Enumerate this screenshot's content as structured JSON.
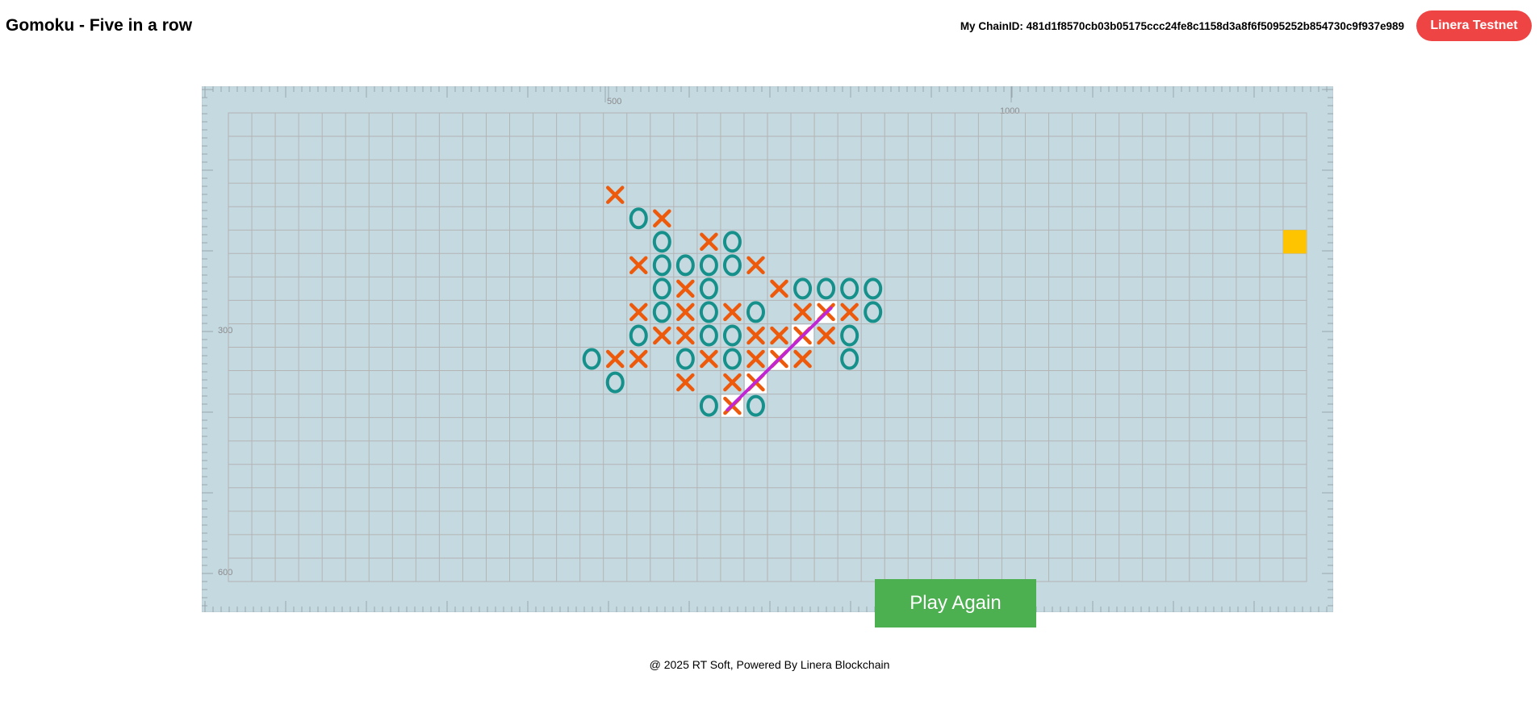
{
  "header": {
    "title": "Gomoku - Five in a row",
    "chain_label": "My ChainID:",
    "chain_id": "481d1f8570cb03b05175ccc24fe8c1158d3a8f6f5095252b854730c9f937e989",
    "network_button": "Linera Testnet"
  },
  "ruler": {
    "labels_top": [
      "500",
      "1000"
    ],
    "labels_left": [
      "300",
      "600"
    ]
  },
  "board": {
    "cols": 46,
    "rows": 20,
    "x_color": "#ee5a0c",
    "o_color": "#16908a",
    "win_line_color": "#c026d3",
    "indicator_color": "#ffc400",
    "pieces": [
      {
        "c": 16,
        "r": 3,
        "p": "X"
      },
      {
        "c": 17,
        "r": 4,
        "p": "O"
      },
      {
        "c": 18,
        "r": 4,
        "p": "X"
      },
      {
        "c": 18,
        "r": 5,
        "p": "O"
      },
      {
        "c": 20,
        "r": 5,
        "p": "X"
      },
      {
        "c": 21,
        "r": 5,
        "p": "O"
      },
      {
        "c": 17,
        "r": 6,
        "p": "X"
      },
      {
        "c": 18,
        "r": 6,
        "p": "O"
      },
      {
        "c": 19,
        "r": 6,
        "p": "O"
      },
      {
        "c": 20,
        "r": 6,
        "p": "O"
      },
      {
        "c": 21,
        "r": 6,
        "p": "O"
      },
      {
        "c": 22,
        "r": 6,
        "p": "X"
      },
      {
        "c": 18,
        "r": 7,
        "p": "O"
      },
      {
        "c": 19,
        "r": 7,
        "p": "X"
      },
      {
        "c": 20,
        "r": 7,
        "p": "O"
      },
      {
        "c": 23,
        "r": 7,
        "p": "X"
      },
      {
        "c": 24,
        "r": 7,
        "p": "O"
      },
      {
        "c": 25,
        "r": 7,
        "p": "O"
      },
      {
        "c": 26,
        "r": 7,
        "p": "O"
      },
      {
        "c": 27,
        "r": 7,
        "p": "O"
      },
      {
        "c": 17,
        "r": 8,
        "p": "X"
      },
      {
        "c": 18,
        "r": 8,
        "p": "O"
      },
      {
        "c": 19,
        "r": 8,
        "p": "X"
      },
      {
        "c": 20,
        "r": 8,
        "p": "O"
      },
      {
        "c": 21,
        "r": 8,
        "p": "X"
      },
      {
        "c": 22,
        "r": 8,
        "p": "O"
      },
      {
        "c": 24,
        "r": 8,
        "p": "X"
      },
      {
        "c": 25,
        "r": 8,
        "p": "X"
      },
      {
        "c": 26,
        "r": 8,
        "p": "X"
      },
      {
        "c": 27,
        "r": 8,
        "p": "O"
      },
      {
        "c": 17,
        "r": 9,
        "p": "O"
      },
      {
        "c": 18,
        "r": 9,
        "p": "X"
      },
      {
        "c": 19,
        "r": 9,
        "p": "X"
      },
      {
        "c": 20,
        "r": 9,
        "p": "O"
      },
      {
        "c": 21,
        "r": 9,
        "p": "O"
      },
      {
        "c": 22,
        "r": 9,
        "p": "X"
      },
      {
        "c": 23,
        "r": 9,
        "p": "X"
      },
      {
        "c": 24,
        "r": 9,
        "p": "X"
      },
      {
        "c": 25,
        "r": 9,
        "p": "X"
      },
      {
        "c": 26,
        "r": 9,
        "p": "O"
      },
      {
        "c": 15,
        "r": 10,
        "p": "O"
      },
      {
        "c": 16,
        "r": 10,
        "p": "X"
      },
      {
        "c": 17,
        "r": 10,
        "p": "X"
      },
      {
        "c": 19,
        "r": 10,
        "p": "O"
      },
      {
        "c": 20,
        "r": 10,
        "p": "X"
      },
      {
        "c": 21,
        "r": 10,
        "p": "O"
      },
      {
        "c": 22,
        "r": 10,
        "p": "X"
      },
      {
        "c": 23,
        "r": 10,
        "p": "X"
      },
      {
        "c": 24,
        "r": 10,
        "p": "X"
      },
      {
        "c": 26,
        "r": 10,
        "p": "O"
      },
      {
        "c": 16,
        "r": 11,
        "p": "O"
      },
      {
        "c": 19,
        "r": 11,
        "p": "X"
      },
      {
        "c": 21,
        "r": 11,
        "p": "X"
      },
      {
        "c": 22,
        "r": 11,
        "p": "X"
      },
      {
        "c": 20,
        "r": 12,
        "p": "O"
      },
      {
        "c": 21,
        "r": 12,
        "p": "X"
      },
      {
        "c": 22,
        "r": 12,
        "p": "O"
      }
    ],
    "winning_cells": [
      {
        "c": 21,
        "r": 12
      },
      {
        "c": 22,
        "r": 11
      },
      {
        "c": 23,
        "r": 10
      },
      {
        "c": 24,
        "r": 9
      },
      {
        "c": 25,
        "r": 8
      }
    ],
    "indicator_cell": {
      "c": 45,
      "r": 5
    }
  },
  "play_again": "Play Again",
  "footer": "@ 2025 RT Soft, Powered By Linera Blockchain"
}
